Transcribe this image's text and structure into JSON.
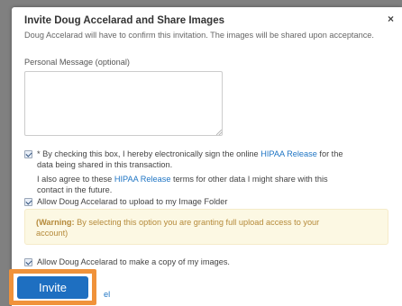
{
  "dialog": {
    "title": "Invite Doug Accelarad and Share Images",
    "close_symbol": "×",
    "description": "Doug Accelarad will have to confirm this invitation. The images will be shared upon acceptance."
  },
  "personal_message": {
    "label": "Personal Message (optional)",
    "value": "",
    "placeholder": ""
  },
  "hipaa_consent": {
    "checked": true,
    "text_before": "* By checking this box, I hereby electronically sign the online ",
    "link_text": "HIPAA Release",
    "text_after": " for the",
    "line2": "data being shared in this transaction.",
    "agree_before": "I also agree to these ",
    "agree_link": "HIPAA Release",
    "agree_after": " terms for other data I might share with this",
    "agree_line2": "contact in the future."
  },
  "upload_permission": {
    "checked": true,
    "label": "Allow Doug Accelarad to upload to my Image Folder"
  },
  "warning": {
    "open_paren": "(",
    "strong": "Warning:",
    "text": " By selecting this option you are granting full upload access to your",
    "line2": "account)"
  },
  "copy_permission": {
    "checked": true,
    "label": "Allow Doug Accelarad to make a copy of my images."
  },
  "actions": {
    "invite_label": "Invite",
    "cancel_label": "el"
  },
  "colors": {
    "primary_button": "#1e6fc1",
    "highlight": "#f0923a",
    "link": "#1f75c4",
    "warning_bg": "#fcf8e3",
    "warning_text": "#b58a3a"
  }
}
